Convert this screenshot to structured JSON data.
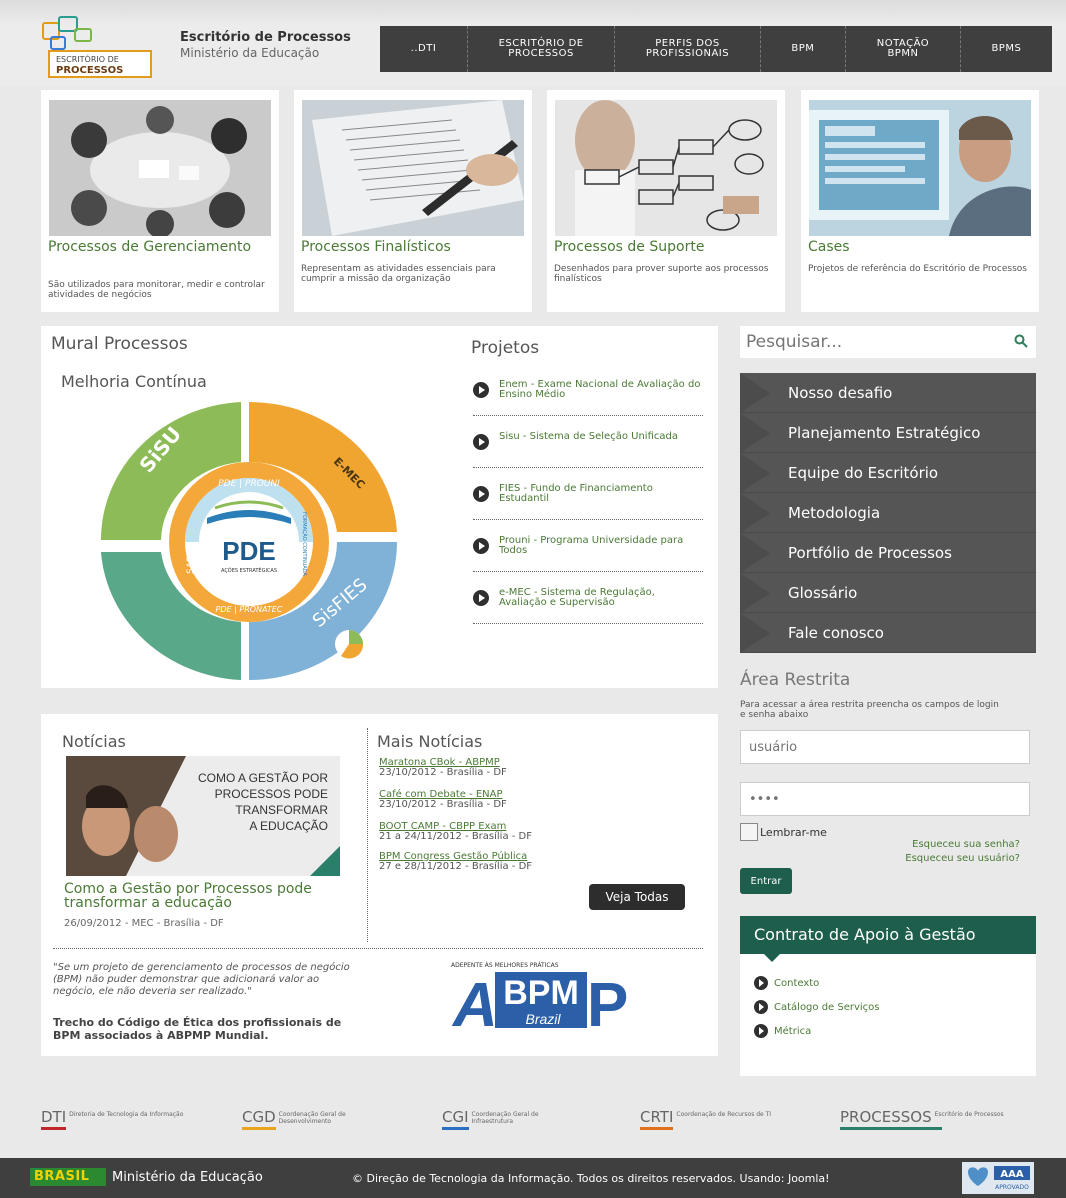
{
  "brand": {
    "logo_line1": "ESCRITÓRIO DE",
    "logo_line2": "PROCESSOS",
    "title": "Escritório de Processos",
    "subtitle": "Ministério da Educação"
  },
  "topnav": [
    {
      "l1": "..DTI",
      "l2": ""
    },
    {
      "l1": "ESCRITÓRIO DE",
      "l2": "PROCESSOS"
    },
    {
      "l1": "PERFIS DOS",
      "l2": "PROFISSIONAIS"
    },
    {
      "l1": "BPM",
      "l2": ""
    },
    {
      "l1": "NOTAÇÃO",
      "l2": "BPMN"
    },
    {
      "l1": "BPMS",
      "l2": ""
    }
  ],
  "cards": [
    {
      "title": "Processos de Gerenciamento",
      "desc": "São utilizados para monitorar, medir e controlar atividades de negócios"
    },
    {
      "title": "Processos Finalísticos",
      "desc": "Representam as atividades essenciais para cumprir a missão da organização"
    },
    {
      "title": "Processos de Suporte",
      "desc": "Desenhados para prover suporte aos processos finalísticos"
    },
    {
      "title": "Cases",
      "desc": "Projetos de referência do Escritório de Processos"
    }
  ],
  "mural": {
    "title": "Mural Processos",
    "subtitle": "Melhoria Contínua",
    "cycle_center": "PDE",
    "cycle_center_sub": "AÇÕES ESTRATÉGICAS",
    "seg_sisu": "SiSU",
    "seg_emec": "E-MEC",
    "seg_sisfies": "SisFIES",
    "seg_sae": "SAE",
    "seg_prouni": "PDE | PROUNI",
    "seg_pronatec": "PDE | PRONATEC",
    "seg_formacao": "FORMAÇÃO CONTINUADA"
  },
  "projetos": {
    "title": "Projetos",
    "items": [
      "Enem - Exame Nacional de Avaliação do Ensino Médio",
      "Sisu - Sistema de Seleção Unificada",
      "FIES - Fundo de Financiamento Estudantil",
      "Prouni - Programa Universidade para Todos",
      "e-MEC - Sistema de Regulação, Avaliação e Supervisão"
    ]
  },
  "search": {
    "placeholder": "Pesquisar..."
  },
  "sidemenu": [
    "Nosso desafio",
    "Planejamento Estratégico",
    "Equipe do Escritório",
    "Metodologia",
    "Portfólio de Processos",
    "Glossário",
    "Fale conosco"
  ],
  "area": {
    "title": "Área Restrita",
    "desc": "Para acessar a área restrita preencha os campos de login e senha abaixo",
    "user_placeholder": "usuário",
    "pass_placeholder": "••••",
    "remember": "Lembrar-me",
    "forgot_pass": "Esqueceu sua senha?",
    "forgot_user": "Esqueceu seu usuário?",
    "submit": "Entrar"
  },
  "contrato": {
    "title": "Contrato de Apoio à Gestão",
    "items": [
      "Contexto",
      "Catálogo de Serviços",
      "Métrica"
    ]
  },
  "noticias": {
    "title": "Notícias",
    "img_text": [
      "COMO A GESTÃO POR",
      "PROCESSOS PODE",
      "TRANSFORMAR",
      "A EDUCAÇÃO"
    ],
    "headline": "Como a Gestão por Processos pode transformar a educação",
    "date": "26/09/2012 - MEC - Brasília - DF"
  },
  "mais": {
    "title": "Mais Notícias",
    "items": [
      {
        "t": "Maratona CBok - ABPMP",
        "d": "23/10/2012 - Brasília - DF"
      },
      {
        "t": "Café com Debate - ENAP",
        "d": "23/10/2012 - Brasília - DF"
      },
      {
        "t": "BOOT CAMP - CBPP Exam",
        "d": "21 a 24/11/2012 - Brasília - DF"
      },
      {
        "t": "BPM Congress Gestão Pública",
        "d": "27 e 28/11/2012 - Brasília - DF"
      }
    ],
    "veja": "Veja Todas"
  },
  "quote": {
    "text": "\"Se um projeto de gerenciamento de processos de negócio (BPM) não puder demonstrar que adicionará valor ao negócio, ele não deveria ser realizado.\"",
    "source": "Trecho do Código de Ética dos profissionais de BPM associados à ABPMP Mundial."
  },
  "abpmp": {
    "caption": "ADEPENTE ÀS MELHORES PRÁTICAS",
    "bpm": "BPM",
    "brazil": "Brazil",
    "a": "A",
    "p": "P"
  },
  "orgs": [
    {
      "ab": "DTI",
      "nm": "Diretoria de Tecnologia da Informação",
      "color": "#c0272d"
    },
    {
      "ab": "CGD",
      "nm": "Coordenação Geral de Desenvolvimento",
      "color": "#e8a41c"
    },
    {
      "ab": "CGI",
      "nm": "Coordenação Geral de Infraestrutura",
      "color": "#2b6fc2"
    },
    {
      "ab": "CRTI",
      "nm": "Coordenação de Recursos de TI",
      "color": "#e0701c"
    },
    {
      "ab": "PROCESSOS",
      "nm": "Escritório de Processos",
      "color": "#2a7f6b"
    }
  ],
  "footer": {
    "brasil": "BRASIL",
    "ministerio": "Ministério da Educação",
    "copyright": "© Direção de Tecnologia da Informação. Todos os direitos reservados. Usando: Joomla!",
    "aaa": "AAA",
    "aaa_sub": "APROVADO"
  },
  "colors": {
    "accent_green": "#4a7a35",
    "dark_teal": "#1e5e4c",
    "nav_dark": "#3f3f3f"
  }
}
